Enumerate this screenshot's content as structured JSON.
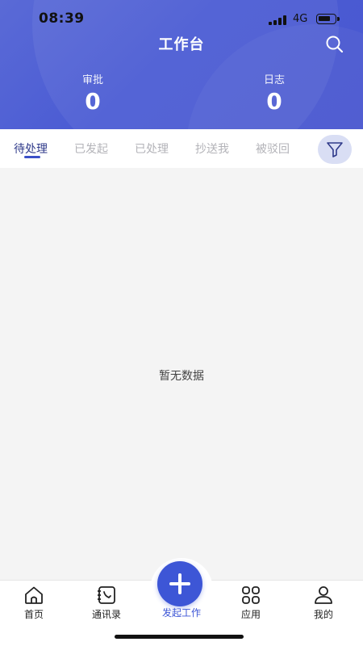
{
  "status_bar": {
    "time": "08:39",
    "network": "4G"
  },
  "header": {
    "title": "工作台",
    "stats": [
      {
        "label": "审批",
        "value": "0"
      },
      {
        "label": "日志",
        "value": "0"
      }
    ]
  },
  "tabs": [
    "待处理",
    "已发起",
    "已处理",
    "抄送我",
    "被驳回"
  ],
  "active_tab": "待处理",
  "empty_text": "暂无数据",
  "bottom_nav": {
    "home": "首页",
    "contacts": "通讯录",
    "start_work": "发起工作",
    "apps": "应用",
    "mine": "我的"
  },
  "colors": {
    "header_blue": "#4a5bd4",
    "accent": "#3d56d6",
    "content_bg": "#f4f4f4"
  }
}
